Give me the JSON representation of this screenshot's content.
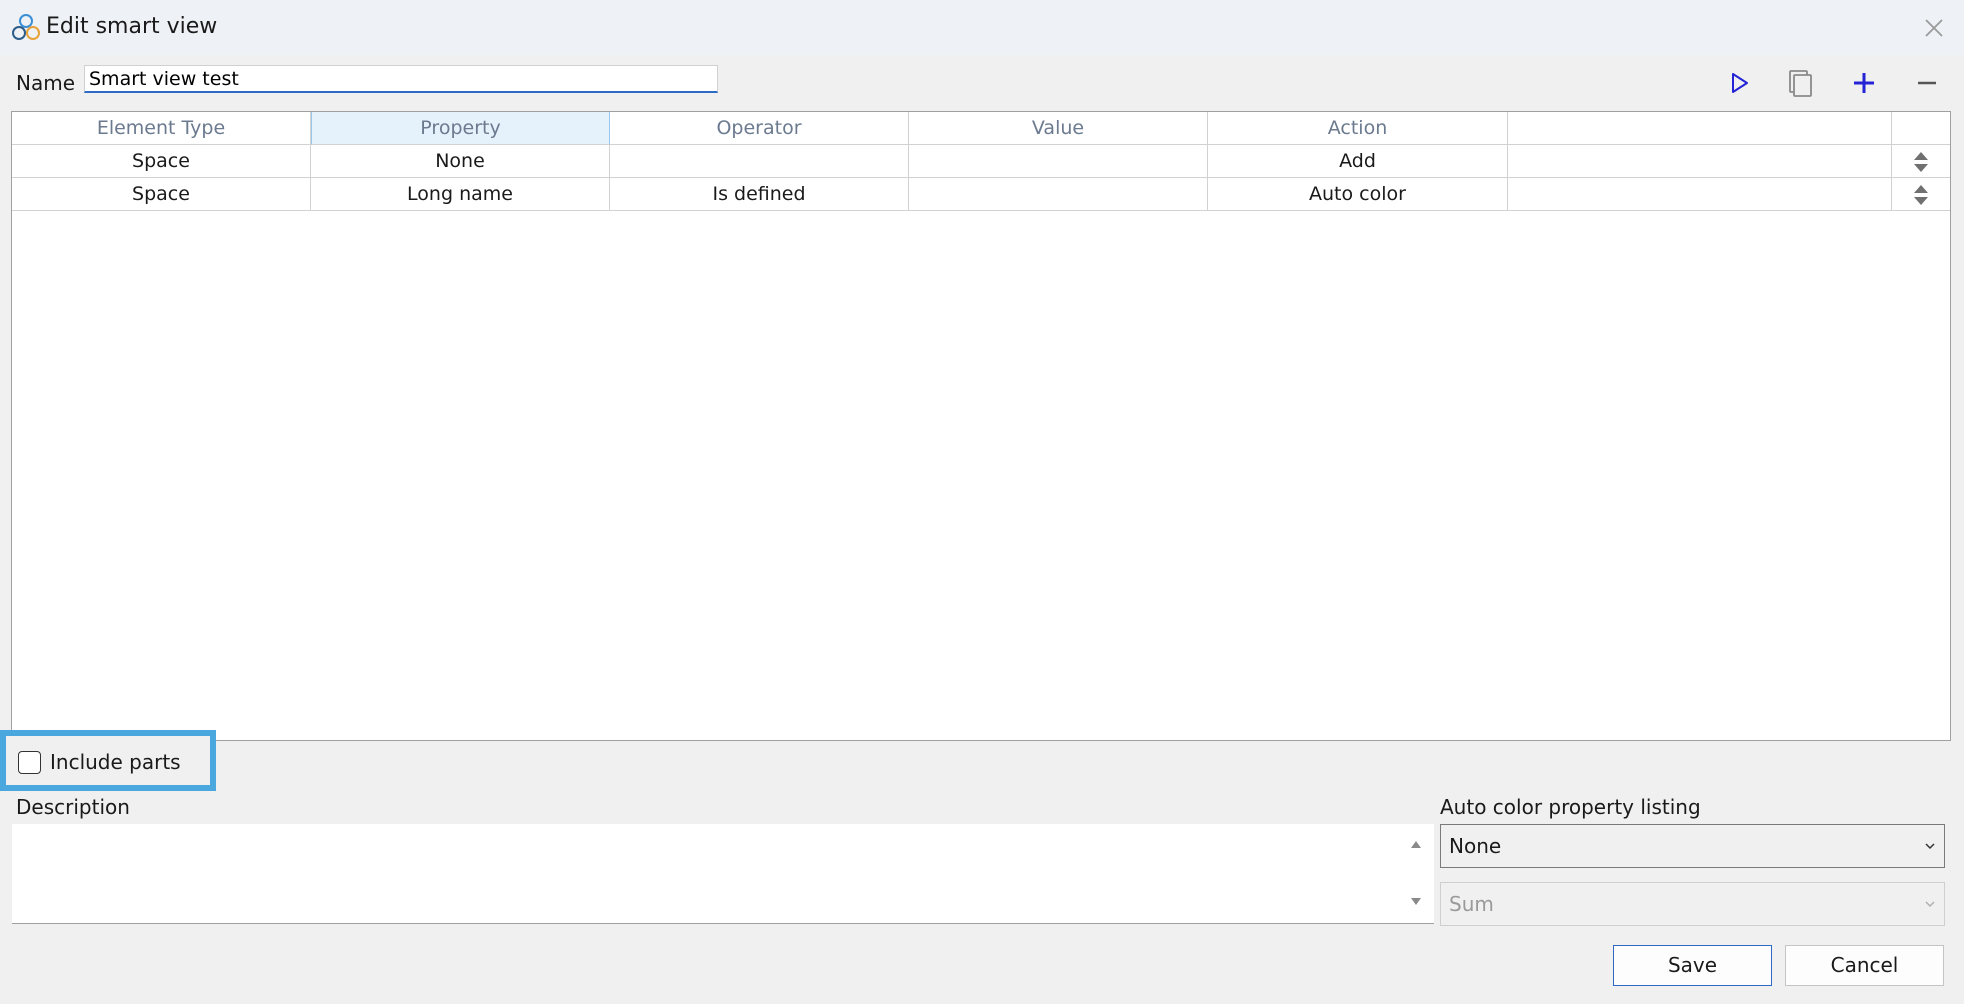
{
  "window": {
    "title": "Edit smart view"
  },
  "name_field": {
    "label": "Name",
    "value": "Smart view test"
  },
  "toolbar": {
    "run_icon": "play-icon",
    "copy_icon": "copy-icon",
    "add_icon": "plus-icon",
    "remove_icon": "minus-icon",
    "accent_color": "#2424d6"
  },
  "grid": {
    "columns": [
      "Element Type",
      "Property",
      "Operator",
      "Value",
      "Action",
      ""
    ],
    "rows": [
      {
        "element_type": "Space",
        "property": "None",
        "operator": "",
        "value": "",
        "action": "Add",
        "extra": ""
      },
      {
        "element_type": "Space",
        "property": "Long name",
        "operator": "Is defined",
        "value": "",
        "action": "Auto color",
        "extra": ""
      }
    ]
  },
  "include_parts": {
    "label": "Include parts",
    "checked": false,
    "highlight_color": "#4aa8de"
  },
  "description": {
    "label": "Description",
    "value": ""
  },
  "auto_color": {
    "label": "Auto color property listing",
    "selected": "None",
    "aggregate": "Sum"
  },
  "buttons": {
    "save": "Save",
    "cancel": "Cancel"
  }
}
